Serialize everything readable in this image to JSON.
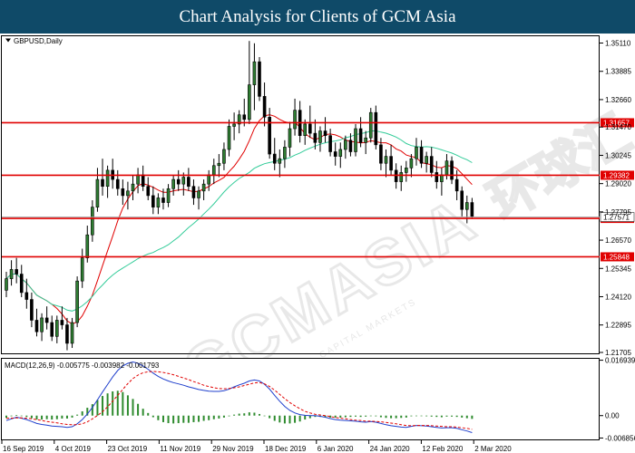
{
  "banner": {
    "title": "Chart Analysis for Clients of GCM Asia"
  },
  "watermark": {
    "main": "GCMASIA",
    "chinese": "环球汇",
    "sub": "GLOBAL CAPITAL MARKETS"
  },
  "colors": {
    "resistance": "#e00000",
    "ma_fast": "#e00000",
    "ma_slow": "#33cc99",
    "candle": "#000000",
    "candle_up_fill": "#2e7d32",
    "macd_hist": "#2e8b2e",
    "macd_line": "#1f3fcc",
    "signal_line": "#e00000",
    "banner_bg": "#0f4a68"
  },
  "chart_data": [
    {
      "type": "candlestick",
      "symbol_label": "GBPUSD,Daily",
      "price_ticks": [
        "1.35110",
        "1.33885",
        "1.32660",
        "1.31470",
        "1.30245",
        "1.29020",
        "1.27795",
        "1.26570",
        "1.25345",
        "1.24120",
        "1.22895",
        "1.21705"
      ],
      "ylim": [
        1.21705,
        1.35405
      ],
      "x_ticks": [
        "16 Sep 2019",
        "4 Oct 2019",
        "23 Oct 2019",
        "11 Nov 2019",
        "29 Nov 2019",
        "18 Dec 2019",
        "6 Jan 2020",
        "24 Jan 2020",
        "12 Feb 2020",
        "2 Mar 2020"
      ],
      "levels": [
        {
          "label": "1.31657",
          "value": 1.31657
        },
        {
          "label": "1.29382",
          "value": 1.29382
        },
        {
          "label": "1.27511",
          "value": 1.27511
        },
        {
          "label": "1.25848",
          "value": 1.25848
        }
      ],
      "current_price": {
        "label": "1.27571",
        "value": 1.27571
      },
      "candles": [
        [
          1.244,
          1.252,
          1.241,
          1.249
        ],
        [
          1.249,
          1.257,
          1.246,
          1.253
        ],
        [
          1.253,
          1.258,
          1.247,
          1.251
        ],
        [
          1.251,
          1.255,
          1.241,
          1.243
        ],
        [
          1.243,
          1.249,
          1.236,
          1.24
        ],
        [
          1.24,
          1.243,
          1.228,
          1.231
        ],
        [
          1.231,
          1.236,
          1.224,
          1.226
        ],
        [
          1.226,
          1.234,
          1.222,
          1.232
        ],
        [
          1.232,
          1.237,
          1.227,
          1.23
        ],
        [
          1.23,
          1.233,
          1.222,
          1.224
        ],
        [
          1.224,
          1.233,
          1.221,
          1.231
        ],
        [
          1.231,
          1.237,
          1.227,
          1.229
        ],
        [
          1.229,
          1.232,
          1.218,
          1.221
        ],
        [
          1.221,
          1.232,
          1.219,
          1.23
        ],
        [
          1.23,
          1.25,
          1.228,
          1.248
        ],
        [
          1.248,
          1.262,
          1.245,
          1.258
        ],
        [
          1.258,
          1.272,
          1.256,
          1.268
        ],
        [
          1.268,
          1.283,
          1.265,
          1.28
        ],
        [
          1.28,
          1.297,
          1.278,
          1.292
        ],
        [
          1.292,
          1.301,
          1.285,
          1.289
        ],
        [
          1.289,
          1.298,
          1.284,
          1.296
        ],
        [
          1.296,
          1.301,
          1.288,
          1.292
        ],
        [
          1.292,
          1.296,
          1.285,
          1.288
        ],
        [
          1.288,
          1.292,
          1.281,
          1.285
        ],
        [
          1.285,
          1.291,
          1.279,
          1.287
        ],
        [
          1.287,
          1.294,
          1.283,
          1.29
        ],
        [
          1.29,
          1.297,
          1.286,
          1.294
        ],
        [
          1.294,
          1.298,
          1.287,
          1.289
        ],
        [
          1.289,
          1.293,
          1.283,
          1.285
        ],
        [
          1.285,
          1.289,
          1.277,
          1.28
        ],
        [
          1.28,
          1.286,
          1.277,
          1.284
        ],
        [
          1.284,
          1.288,
          1.279,
          1.282
        ],
        [
          1.282,
          1.29,
          1.28,
          1.288
        ],
        [
          1.288,
          1.294,
          1.285,
          1.292
        ],
        [
          1.292,
          1.296,
          1.287,
          1.29
        ],
        [
          1.29,
          1.295,
          1.285,
          1.293
        ],
        [
          1.293,
          1.297,
          1.287,
          1.289
        ],
        [
          1.289,
          1.292,
          1.281,
          1.284
        ],
        [
          1.284,
          1.289,
          1.279,
          1.287
        ],
        [
          1.287,
          1.292,
          1.283,
          1.29
        ],
        [
          1.29,
          1.296,
          1.287,
          1.294
        ],
        [
          1.294,
          1.301,
          1.29,
          1.298
        ],
        [
          1.298,
          1.303,
          1.293,
          1.299
        ],
        [
          1.299,
          1.308,
          1.296,
          1.305
        ],
        [
          1.305,
          1.318,
          1.302,
          1.315
        ],
        [
          1.315,
          1.321,
          1.309,
          1.316
        ],
        [
          1.316,
          1.322,
          1.312,
          1.32
        ],
        [
          1.32,
          1.327,
          1.315,
          1.318
        ],
        [
          1.318,
          1.352,
          1.316,
          1.333
        ],
        [
          1.333,
          1.351,
          1.322,
          1.343
        ],
        [
          1.343,
          1.345,
          1.326,
          1.328
        ],
        [
          1.328,
          1.334,
          1.315,
          1.319
        ],
        [
          1.319,
          1.323,
          1.301,
          1.303
        ],
        [
          1.303,
          1.31,
          1.296,
          1.299
        ],
        [
          1.299,
          1.305,
          1.293,
          1.301
        ],
        [
          1.301,
          1.309,
          1.297,
          1.306
        ],
        [
          1.306,
          1.317,
          1.302,
          1.314
        ],
        [
          1.314,
          1.327,
          1.311,
          1.322
        ],
        [
          1.322,
          1.326,
          1.308,
          1.311
        ],
        [
          1.311,
          1.318,
          1.307,
          1.316
        ],
        [
          1.316,
          1.324,
          1.31,
          1.312
        ],
        [
          1.312,
          1.318,
          1.305,
          1.308
        ],
        [
          1.308,
          1.315,
          1.304,
          1.313
        ],
        [
          1.313,
          1.319,
          1.308,
          1.311
        ],
        [
          1.311,
          1.314,
          1.302,
          1.304
        ],
        [
          1.304,
          1.308,
          1.298,
          1.302
        ],
        [
          1.302,
          1.308,
          1.297,
          1.305
        ],
        [
          1.305,
          1.311,
          1.301,
          1.309
        ],
        [
          1.309,
          1.312,
          1.302,
          1.304
        ],
        [
          1.304,
          1.316,
          1.302,
          1.314
        ],
        [
          1.314,
          1.319,
          1.306,
          1.308
        ],
        [
          1.308,
          1.313,
          1.303,
          1.31
        ],
        [
          1.31,
          1.323,
          1.308,
          1.321
        ],
        [
          1.321,
          1.324,
          1.305,
          1.307
        ],
        [
          1.307,
          1.31,
          1.296,
          1.299
        ],
        [
          1.299,
          1.305,
          1.293,
          1.302
        ],
        [
          1.302,
          1.307,
          1.294,
          1.296
        ],
        [
          1.296,
          1.299,
          1.288,
          1.291
        ],
        [
          1.291,
          1.298,
          1.287,
          1.295
        ],
        [
          1.295,
          1.3,
          1.291,
          1.297
        ],
        [
          1.297,
          1.303,
          1.293,
          1.301
        ],
        [
          1.301,
          1.31,
          1.298,
          1.306
        ],
        [
          1.306,
          1.309,
          1.297,
          1.299
        ],
        [
          1.299,
          1.304,
          1.295,
          1.302
        ],
        [
          1.302,
          1.306,
          1.293,
          1.295
        ],
        [
          1.295,
          1.3,
          1.288,
          1.291
        ],
        [
          1.291,
          1.297,
          1.285,
          1.294
        ],
        [
          1.294,
          1.303,
          1.292,
          1.3
        ],
        [
          1.3,
          1.302,
          1.29,
          1.292
        ],
        [
          1.292,
          1.296,
          1.283,
          1.287
        ],
        [
          1.287,
          1.289,
          1.276,
          1.279
        ],
        [
          1.279,
          1.285,
          1.273,
          1.282
        ],
        [
          1.282,
          1.284,
          1.275,
          1.276
        ]
      ]
    },
    {
      "type": "line",
      "label": "MACD(12,26,9) -0.005775 -0.003982 -0.001793",
      "price_ticks": [
        "0.016939",
        "0.00",
        "-0.006856"
      ],
      "ylim": [
        -0.007,
        0.0171
      ],
      "series": [
        {
          "values": [
            -0.0015,
            -0.001,
            -0.0005,
            -0.0008,
            -0.0012,
            -0.0018,
            -0.0024,
            -0.0027,
            -0.0029,
            -0.0032,
            -0.0033,
            -0.0034,
            -0.0036,
            -0.0034,
            -0.0025,
            -0.0012,
            0.0005,
            0.0025,
            0.0048,
            0.0072,
            0.0095,
            0.0118,
            0.0138,
            0.0152,
            0.016,
            0.0164,
            0.016,
            0.0152,
            0.0142,
            0.013,
            0.012,
            0.0112,
            0.0106,
            0.0101,
            0.0097,
            0.0093,
            0.0088,
            0.0084,
            0.008,
            0.0077,
            0.0075,
            0.0074,
            0.0074,
            0.0076,
            0.0081,
            0.0088,
            0.0094,
            0.0099,
            0.0106,
            0.0109,
            0.0106,
            0.0096,
            0.0081,
            0.0062,
            0.0044,
            0.0028,
            0.0016,
            0.0008,
            0.0003,
            0.0001,
            0.0,
            0.0,
            -0.0002,
            -0.0005,
            -0.0009,
            -0.0012,
            -0.0014,
            -0.0015,
            -0.0016,
            -0.0017,
            -0.0019,
            -0.002,
            -0.0018,
            -0.002,
            -0.0024,
            -0.0028,
            -0.0031,
            -0.0033,
            -0.0035,
            -0.0036,
            -0.0033,
            -0.003,
            -0.0031,
            -0.0032,
            -0.0034,
            -0.0036,
            -0.0038,
            -0.0037,
            -0.0037,
            -0.0039,
            -0.0043,
            -0.0047,
            -0.0052
          ]
        },
        {
          "values": [
            -0.0008,
            -0.0008,
            -0.0007,
            -0.0007,
            -0.0008,
            -0.001,
            -0.0012,
            -0.0015,
            -0.0018,
            -0.002,
            -0.0022,
            -0.0025,
            -0.0027,
            -0.0028,
            -0.0028,
            -0.0025,
            -0.0019,
            -0.001,
            0.0,
            0.0012,
            0.0027,
            0.0044,
            0.0062,
            0.008,
            0.0098,
            0.0113,
            0.0124,
            0.0131,
            0.0134,
            0.0135,
            0.0134,
            0.0132,
            0.0129,
            0.0125,
            0.012,
            0.0115,
            0.011,
            0.0104,
            0.0099,
            0.0093,
            0.0089,
            0.0085,
            0.0083,
            0.0082,
            0.0083,
            0.0085,
            0.0088,
            0.0092,
            0.0096,
            0.01,
            0.0101,
            0.0097,
            0.0089,
            0.0078,
            0.0065,
            0.0052,
            0.004,
            0.003,
            0.0021,
            0.0013,
            0.0008,
            0.0004,
            0.0002,
            0.0,
            -0.0003,
            -0.0006,
            -0.0008,
            -0.001,
            -0.0012,
            -0.0014,
            -0.0015,
            -0.0017,
            -0.0017,
            -0.0018,
            -0.0019,
            -0.0021,
            -0.0023,
            -0.0025,
            -0.0028,
            -0.003,
            -0.0031,
            -0.003,
            -0.003,
            -0.003,
            -0.0031,
            -0.0032,
            -0.0033,
            -0.0034,
            -0.0034,
            -0.0035,
            -0.0037,
            -0.0039,
            -0.0042
          ]
        }
      ],
      "histogram": [
        -0.0007,
        -0.0002,
        0.0002,
        -0.0001,
        -0.0004,
        -0.0008,
        -0.0012,
        -0.0012,
        -0.0011,
        -0.0012,
        -0.0011,
        -0.0009,
        -0.0009,
        -0.0006,
        0.0003,
        0.0013,
        0.0024,
        0.0035,
        0.0048,
        0.006,
        0.0068,
        0.0074,
        0.0076,
        0.0072,
        0.0062,
        0.0051,
        0.0036,
        0.0021,
        0.0008,
        -0.0005,
        -0.0014,
        -0.002,
        -0.0023,
        -0.0024,
        -0.0023,
        -0.0022,
        -0.0022,
        -0.002,
        -0.0019,
        -0.0016,
        -0.0014,
        -0.0011,
        -0.0009,
        -0.0006,
        -0.0002,
        0.0003,
        0.0006,
        0.0007,
        0.001,
        0.0009,
        0.0005,
        -0.0001,
        -0.0008,
        -0.0016,
        -0.0021,
        -0.0024,
        -0.0024,
        -0.0022,
        -0.0018,
        -0.0012,
        -0.0008,
        -0.0004,
        -0.0004,
        -0.0005,
        -0.0006,
        -0.0006,
        -0.0006,
        -0.0005,
        -0.0004,
        -0.0003,
        -0.0004,
        -0.0003,
        -0.0001,
        -0.0002,
        -0.0005,
        -0.0007,
        -0.0008,
        -0.0008,
        -0.0007,
        -0.0006,
        -0.0002,
        0.0,
        -0.0001,
        -0.0002,
        -0.0003,
        -0.0004,
        -0.0005,
        -0.0003,
        -0.0003,
        -0.0004,
        -0.0006,
        -0.0008,
        -0.001
      ]
    }
  ]
}
